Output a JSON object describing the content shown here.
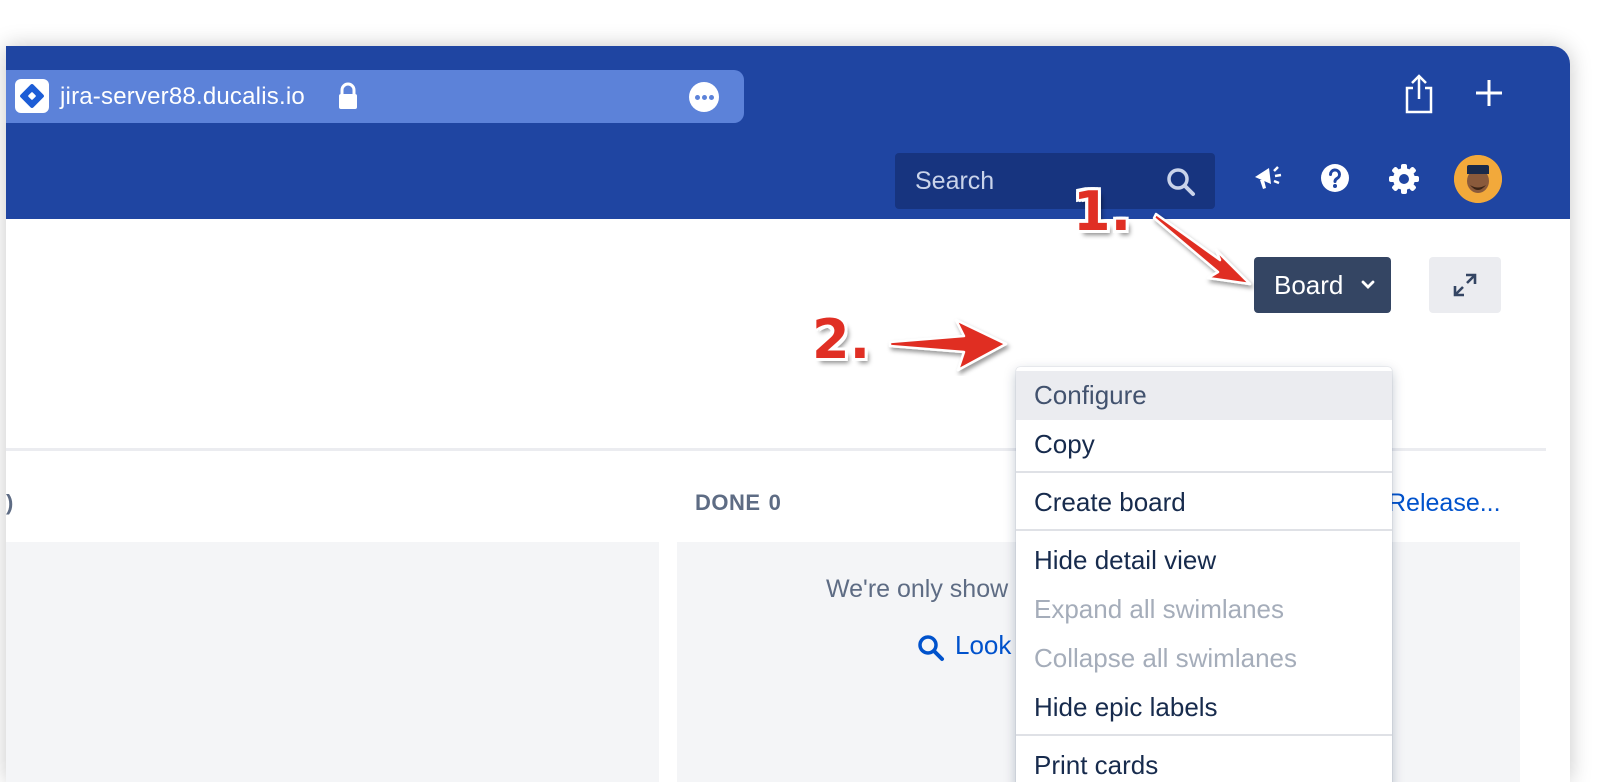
{
  "browser": {
    "url": "jira-server88.ducalis.io",
    "site_icon": "jira-diamond-icon",
    "icons": [
      "lock-icon",
      "more-icon",
      "share-icon",
      "plus-icon"
    ]
  },
  "header": {
    "search_placeholder": "Search",
    "icons": [
      "search-icon",
      "megaphone-icon",
      "help-icon",
      "gear-icon",
      "avatar"
    ]
  },
  "toolbar": {
    "board_label": "Board",
    "expand_icon": "expand-icon"
  },
  "board_menu": {
    "items": [
      {
        "label": "Configure",
        "state": "highlighted"
      },
      {
        "label": "Copy",
        "state": "enabled"
      },
      {
        "label": "Create board",
        "state": "enabled"
      },
      {
        "label": "Hide detail view",
        "state": "enabled"
      },
      {
        "label": "Expand all swimlanes",
        "state": "disabled"
      },
      {
        "label": "Collapse all swimlanes",
        "state": "disabled"
      },
      {
        "label": "Hide epic labels",
        "state": "enabled"
      },
      {
        "label": "Print cards",
        "state": "enabled"
      }
    ]
  },
  "columns": {
    "left_count_fragment": ")",
    "done_label": "DONE",
    "done_count": "0",
    "release_link": "Release...",
    "done_message": "We're only show",
    "look_link": "Look"
  },
  "annotations": {
    "step1": "1.",
    "step2": "2.",
    "arrow_color": "#e02f24"
  },
  "colors": {
    "chrome_blue": "#1f45a2",
    "url_bar": "#5c82d9",
    "search_bg": "#17347f",
    "board_button": "#344563",
    "link": "#0052cc"
  }
}
